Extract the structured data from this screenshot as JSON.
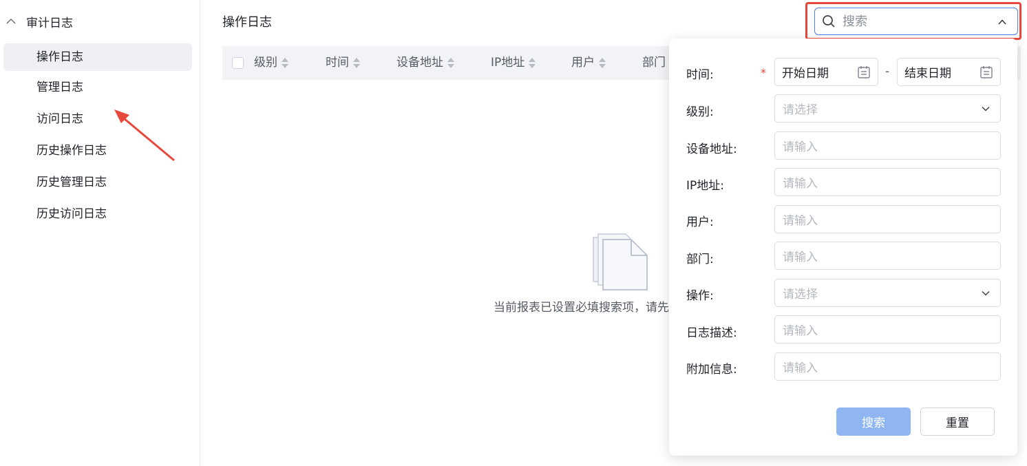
{
  "sidebar": {
    "group_label": "审计日志",
    "items": [
      {
        "label": "操作日志",
        "active": true
      },
      {
        "label": "管理日志",
        "active": false
      },
      {
        "label": "访问日志",
        "active": false
      },
      {
        "label": "历史操作日志",
        "active": false
      },
      {
        "label": "历史管理日志",
        "active": false
      },
      {
        "label": "历史访问日志",
        "active": false
      }
    ]
  },
  "header": {
    "title": "操作日志"
  },
  "table": {
    "columns": [
      "级别",
      "时间",
      "设备地址",
      "IP地址",
      "用户",
      "部门"
    ]
  },
  "empty": {
    "text": "当前报表已设置必填搜索项，请先"
  },
  "search": {
    "placeholder": "搜索"
  },
  "filter": {
    "time_label": "时间:",
    "required_mark": "*",
    "start_date": "开始日期",
    "date_sep": "-",
    "end_date": "结束日期",
    "fields": [
      {
        "label": "级别:",
        "placeholder": "请选择",
        "type": "select"
      },
      {
        "label": "设备地址:",
        "placeholder": "请输入",
        "type": "input"
      },
      {
        "label": "IP地址:",
        "placeholder": "请输入",
        "type": "input"
      },
      {
        "label": "用户:",
        "placeholder": "请输入",
        "type": "input"
      },
      {
        "label": "部门:",
        "placeholder": "请输入",
        "type": "input"
      },
      {
        "label": "操作:",
        "placeholder": "请选择",
        "type": "select"
      },
      {
        "label": "日志描述:",
        "placeholder": "请输入",
        "type": "input"
      },
      {
        "label": "附加信息:",
        "placeholder": "请输入",
        "type": "input"
      }
    ],
    "search_button": "搜索",
    "reset_button": "重置"
  },
  "colors": {
    "accent": "#4e7ee8",
    "highlight": "#e8473b",
    "button_primary": "#8fb6f2"
  }
}
